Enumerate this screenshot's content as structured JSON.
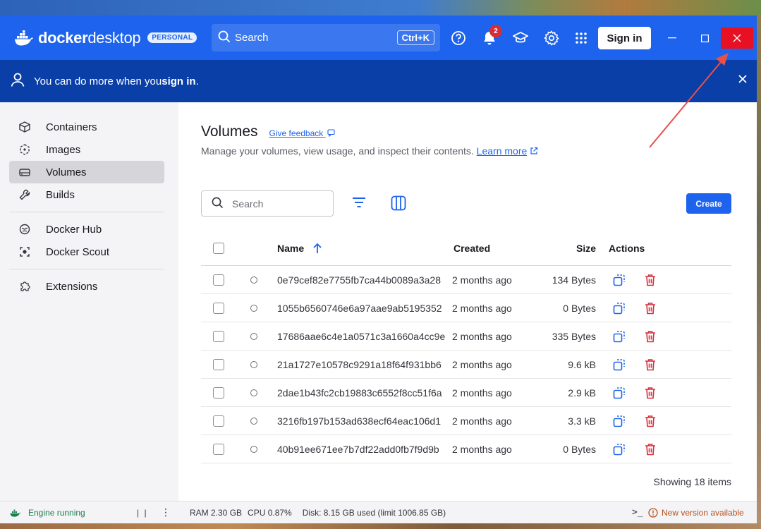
{
  "app": {
    "logo_text_1": "docker",
    "logo_text_2": "desktop",
    "plan_badge": "PERSONAL"
  },
  "topbar": {
    "search_placeholder": "Search",
    "search_shortcut": "Ctrl+K",
    "notification_count": "2",
    "sign_in_label": "Sign in"
  },
  "banner": {
    "text": "You can do more when you ",
    "link": "sign in",
    "suffix": "."
  },
  "sidebar": {
    "items": [
      {
        "label": "Containers",
        "icon": "container-icon"
      },
      {
        "label": "Images",
        "icon": "image-icon"
      },
      {
        "label": "Volumes",
        "icon": "volume-icon",
        "active": true
      },
      {
        "label": "Builds",
        "icon": "wrench-icon"
      },
      {
        "label": "Docker Hub",
        "icon": "hub-icon"
      },
      {
        "label": "Docker Scout",
        "icon": "scout-icon"
      },
      {
        "label": "Extensions",
        "icon": "puzzle-icon"
      }
    ]
  },
  "main": {
    "title": "Volumes",
    "feedback_link": "Give feedback",
    "subtitle": "Manage your volumes, view usage, and inspect their contents.",
    "learn_more": "Learn more",
    "search_placeholder": "Search",
    "create_label": "Create"
  },
  "table": {
    "headers": {
      "name": "Name",
      "created": "Created",
      "size": "Size",
      "actions": "Actions"
    },
    "rows": [
      {
        "name": "0e79cef82e7755fb7ca44b0089a3a28",
        "created": "2 months ago",
        "size": "134 Bytes"
      },
      {
        "name": "1055b6560746e6a97aae9ab5195352",
        "created": "2 months ago",
        "size": "0 Bytes"
      },
      {
        "name": "17686aae6c4e1a0571c3a1660a4cc9e",
        "created": "2 months ago",
        "size": "335 Bytes"
      },
      {
        "name": "21a1727e10578c9291a18f64f931bb6",
        "created": "2 months ago",
        "size": "9.6 kB"
      },
      {
        "name": "2dae1b43fc2cb19883c6552f8cc51f6a",
        "created": "2 months ago",
        "size": "2.9 kB"
      },
      {
        "name": "3216fb197b153ad638ecf64eac106d1",
        "created": "2 months ago",
        "size": "3.3 kB"
      },
      {
        "name": "40b91ee671ee7b7df22add0fb7f9d9b",
        "created": "2 months ago",
        "size": "0 Bytes"
      }
    ],
    "showing": "Showing 18 items"
  },
  "statusbar": {
    "engine": "Engine running",
    "pause": "| |",
    "ram": "RAM 2.30 GB",
    "cpu": "CPU 0.87%",
    "disk": "Disk: 8.15 GB used (limit 1006.85 GB)",
    "terminal": ">_",
    "update": "New version available"
  },
  "colors": {
    "brand_blue": "#1d63ed",
    "banner_blue": "#0a3fa7",
    "danger_red": "#d62d3a",
    "close_red": "#e81123",
    "annotation_red": "#e8504a"
  }
}
